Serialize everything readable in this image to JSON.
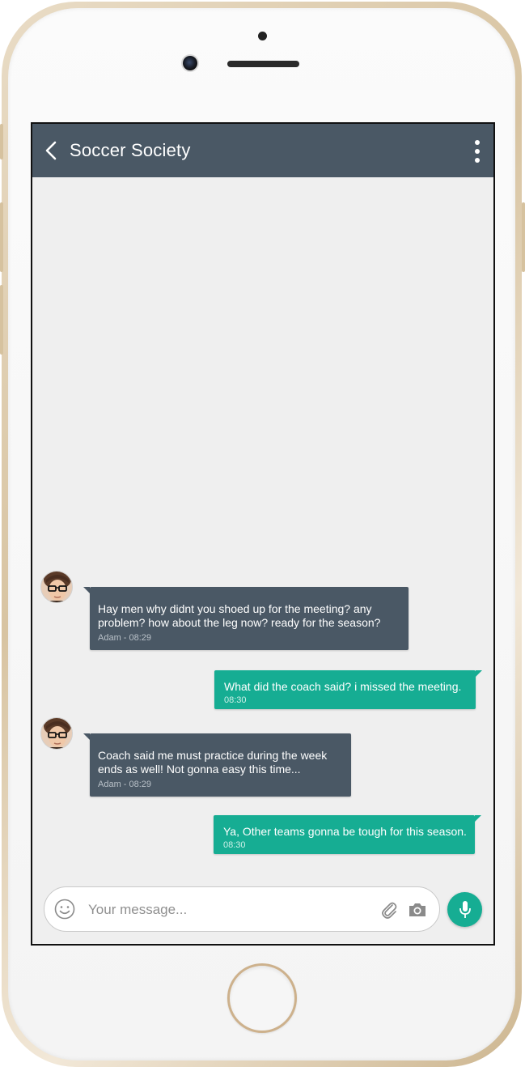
{
  "app": {
    "title": "Soccer Society",
    "icons": {
      "back": "back-arrow-icon",
      "more": "more-vertical-icon",
      "emoji": "emoji-icon",
      "attach": "paperclip-icon",
      "camera": "camera-icon",
      "mic": "microphone-icon"
    }
  },
  "colors": {
    "appbar": "#4a5865",
    "incoming_bubble": "#4a5865",
    "outgoing_bubble": "#16ad93",
    "screen_bg": "#efefef"
  },
  "messages": [
    {
      "direction": "incoming",
      "text": "Hay men why didnt you shoed up for the meeting? any\nproblem? how about the leg now? ready for the season?",
      "meta": "Adam - 08:29"
    },
    {
      "direction": "outgoing",
      "text": "What did the coach said? i missed the meeting.",
      "meta": "08:30"
    },
    {
      "direction": "incoming",
      "text": "Coach said me must practice during the week\nends as well! Not gonna easy this time...",
      "meta": "Adam - 08:29"
    },
    {
      "direction": "outgoing",
      "text": "Ya, Other teams gonna be tough for this season.",
      "meta": "08:30"
    }
  ],
  "composer": {
    "placeholder": "Your message...",
    "value": ""
  }
}
